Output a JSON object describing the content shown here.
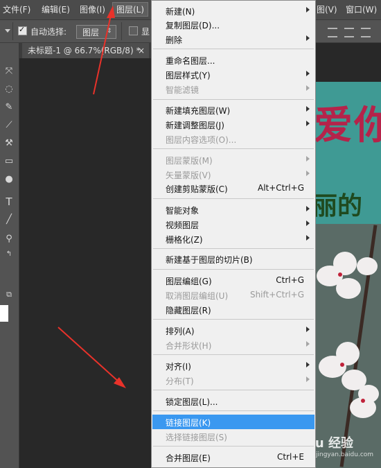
{
  "menubar": {
    "items": [
      {
        "label": "文件(F)"
      },
      {
        "label": "编辑(E)"
      },
      {
        "label": "图像(I)"
      },
      {
        "label": "图层(L)"
      },
      {
        "label": "图(V)"
      },
      {
        "label": "窗口(W)"
      }
    ]
  },
  "options": {
    "auto_select_label": "自动选择:",
    "auto_select_value": "图层",
    "show_label": "显"
  },
  "tab": {
    "title": "未标题-1 @ 66.7%(RGB/8) *",
    "close": "×"
  },
  "canvas": {
    "text1": "爱你",
    "text2": "丽的"
  },
  "watermark": {
    "text": "Baidu 经验",
    "sub": "jingyan.baidu.com"
  },
  "menu": {
    "items": [
      {
        "label": "新建(N)",
        "submenu": true,
        "disabled": false
      },
      {
        "label": "复制图层(D)...",
        "disabled": false
      },
      {
        "label": "删除",
        "submenu": true,
        "disabled": false
      },
      {
        "label": "重命名图层...",
        "disabled": false
      },
      {
        "label": "图层样式(Y)",
        "submenu": true,
        "disabled": false
      },
      {
        "label": "智能滤镜",
        "submenu": true,
        "disabled": true
      },
      {
        "label": "新建填充图层(W)",
        "submenu": true,
        "disabled": false
      },
      {
        "label": "新建调整图层(J)",
        "submenu": true,
        "disabled": false
      },
      {
        "label": "图层内容选项(O)...",
        "disabled": true
      },
      {
        "label": "图层蒙版(M)",
        "submenu": true,
        "disabled": true
      },
      {
        "label": "矢量蒙版(V)",
        "submenu": true,
        "disabled": true
      },
      {
        "label": "创建剪贴蒙版(C)",
        "shortcut": "Alt+Ctrl+G",
        "disabled": false
      },
      {
        "label": "智能对象",
        "submenu": true,
        "disabled": false
      },
      {
        "label": "视频图层",
        "submenu": true,
        "disabled": false
      },
      {
        "label": "栅格化(Z)",
        "submenu": true,
        "disabled": false
      },
      {
        "label": "新建基于图层的切片(B)",
        "disabled": false
      },
      {
        "label": "图层编组(G)",
        "shortcut": "Ctrl+G",
        "disabled": false
      },
      {
        "label": "取消图层编组(U)",
        "shortcut": "Shift+Ctrl+G",
        "disabled": true
      },
      {
        "label": "隐藏图层(R)",
        "disabled": false
      },
      {
        "label": "排列(A)",
        "submenu": true,
        "disabled": false
      },
      {
        "label": "合并形状(H)",
        "submenu": true,
        "disabled": true
      },
      {
        "label": "对齐(I)",
        "submenu": true,
        "disabled": false
      },
      {
        "label": "分布(T)",
        "submenu": true,
        "disabled": true
      },
      {
        "label": "锁定图层(L)...",
        "disabled": false
      },
      {
        "label": "链接图层(K)",
        "highlighted": true,
        "disabled": false
      },
      {
        "label": "选择链接图层(S)",
        "disabled": true
      },
      {
        "label": "合并图层(E)",
        "shortcut": "Ctrl+E",
        "disabled": false
      }
    ]
  },
  "colors": {
    "highlight": "#3a98f0",
    "arrow": "#e8322a"
  },
  "icons": [
    "move-tool-icon",
    "lasso-tool-icon",
    "eyedropper-tool-icon",
    "brush-tool-icon",
    "stamp-tool-icon",
    "gradient-tool-icon",
    "dodge-tool-icon",
    "type-tool-icon",
    "line-tool-icon",
    "zoom-tool-icon",
    "swap-colors-icon",
    "screen-mode-icon"
  ]
}
